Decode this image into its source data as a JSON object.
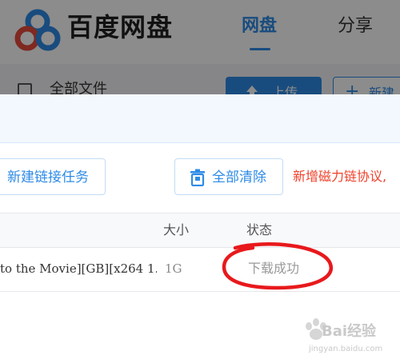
{
  "app": {
    "brand": "百度网盘",
    "nav": {
      "disk": "网盘",
      "share": "分享"
    },
    "sidebar": {
      "all_files": "全部文件"
    },
    "toolbar": {
      "upload": "上传",
      "new_folder": "新建"
    }
  },
  "dialog": {
    "buttons": {
      "new_link_task": "新建链接任务",
      "clear_all": "全部清除"
    },
    "notice": "新增磁力链协议,",
    "table": {
      "headers": {
        "size": "大小",
        "status": "状态"
      },
      "rows": [
        {
          "name": "to the Movie][GB][x264 1...",
          "size": "1G",
          "status": "下载成功"
        }
      ]
    }
  },
  "watermark": {
    "text": "Bai经验",
    "sub": "jingyan.baidu.com"
  },
  "colors": {
    "accent": "#2e8be6",
    "notice": "#f0412b",
    "annotation": "#e8191c"
  }
}
